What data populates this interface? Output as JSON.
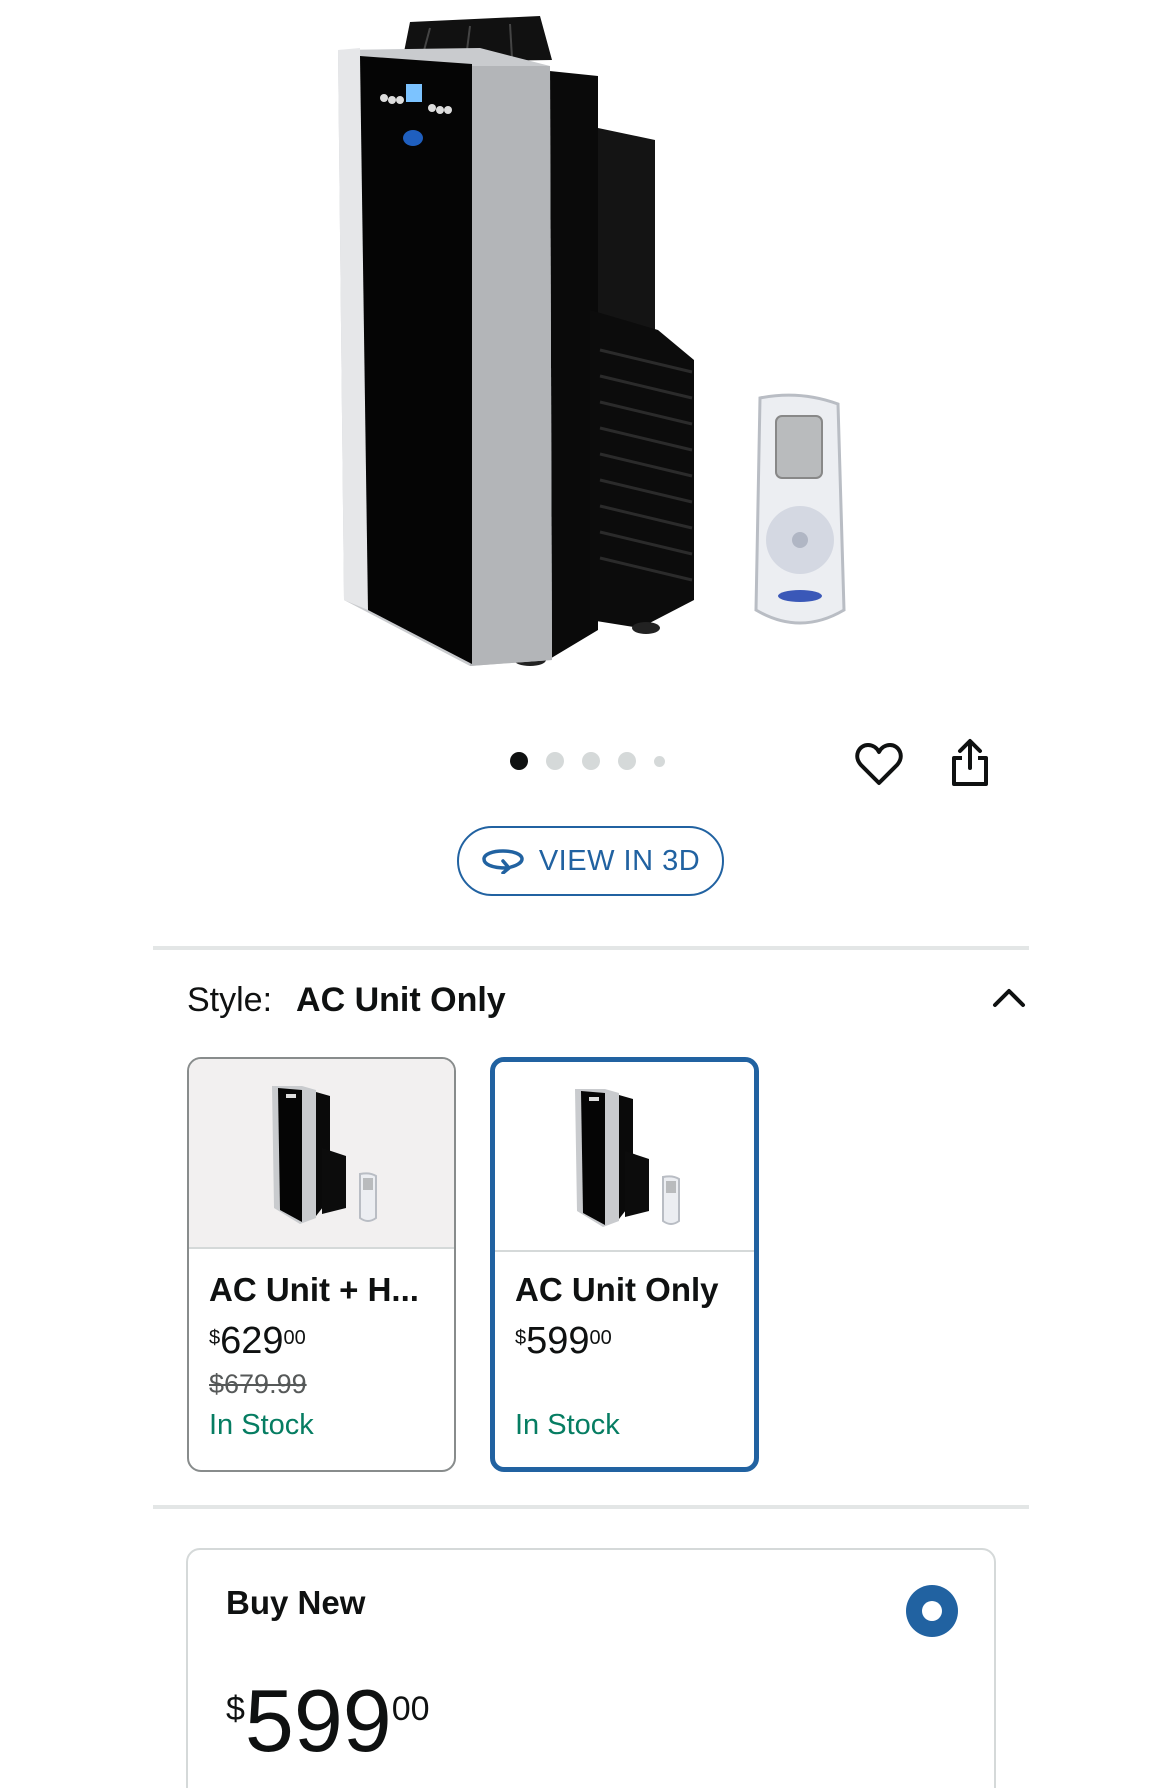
{
  "hero": {
    "image_alt": "portable air conditioner with remote",
    "carousel_count": 5,
    "carousel_active_index": 0,
    "favorite_icon": "heart-icon",
    "share_icon": "share-icon"
  },
  "view3d": {
    "label": "VIEW IN 3D",
    "icon": "rotate-3d-icon"
  },
  "style": {
    "label": "Style:",
    "selected": "AC Unit Only",
    "toggle_icon": "chevron-up-icon",
    "options": [
      {
        "name": "AC Unit + H...",
        "price_symbol": "$",
        "price_whole": "629",
        "price_fraction": "00",
        "list_price": "$679.99",
        "stock": "In Stock",
        "selected": false
      },
      {
        "name": "AC Unit Only",
        "price_symbol": "$",
        "price_whole": "599",
        "price_fraction": "00",
        "list_price": "",
        "stock": "In Stock",
        "selected": true
      }
    ]
  },
  "buy_new": {
    "title": "Buy New",
    "price_symbol": "$",
    "price_whole": "599",
    "price_fraction": "00",
    "selected": true
  },
  "colors": {
    "accent": "#2162a1",
    "stock_green": "#067d62",
    "text": "#0f1111"
  }
}
